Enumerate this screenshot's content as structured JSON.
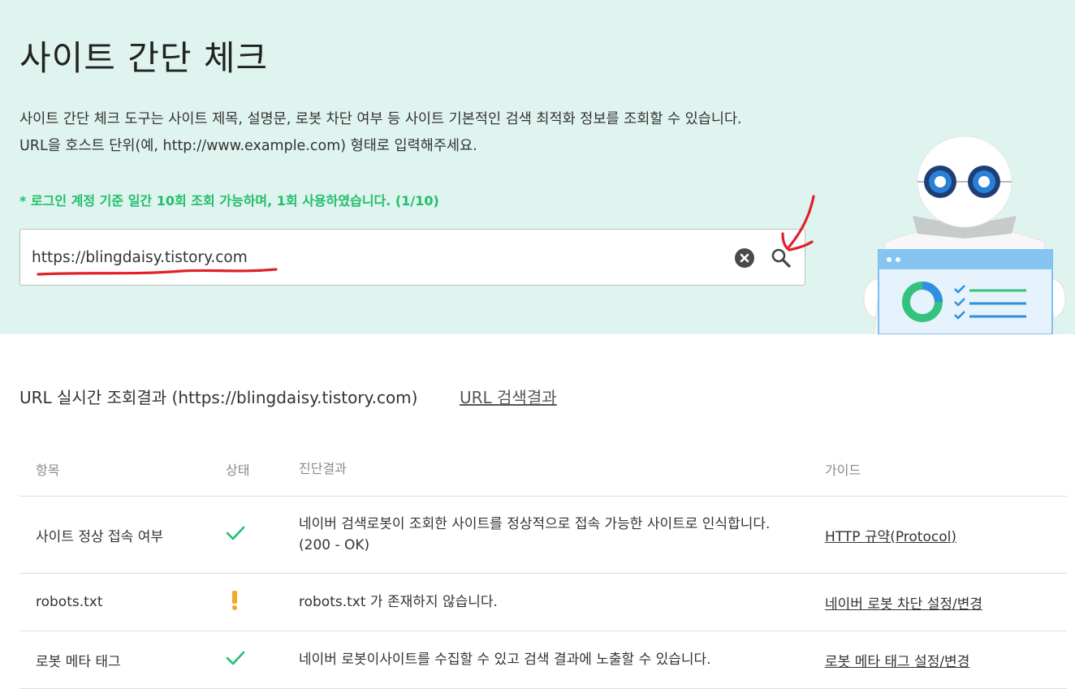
{
  "hero": {
    "title": "사이트 간단 체크",
    "description_line1": "사이트 간단 체크 도구는 사이트 제목, 설명문, 로봇 차단 여부 등 사이트 기본적인 검색 최적화 정보를 조회할 수 있습니다.",
    "description_line2": "URL을 호스트 단위(예, http://www.example.com) 형태로 입력해주세요.",
    "notice": "* 로그인 계정 기준 일간 10회 조회 가능하며, 1회 사용하였습니다. (1/10)",
    "background_color": "#dff3ef",
    "notice_color": "#1fbf6a"
  },
  "search": {
    "value": "https://blingdaisy.tistory.com",
    "clear_icon": "clear-circle-x-icon",
    "search_icon": "magnifier-icon"
  },
  "annotations": {
    "color": "#e0202a",
    "items": [
      "red-underline",
      "red-arrow"
    ]
  },
  "results": {
    "heading": "URL 실시간 조회결과 (https://blingdaisy.tistory.com)",
    "search_results_link": "URL 검색결과",
    "columns": [
      "항목",
      "상태",
      "진단결과",
      "가이드"
    ],
    "rows": [
      {
        "item": "사이트 정상 접속 여부",
        "status": "ok",
        "status_icon": "check-icon",
        "result_line1": "네이버 검색로봇이 조회한 사이트를 정상적으로 접속 가능한 사이트로 인식합니다.",
        "result_line2": "(200 - OK)",
        "guide": "HTTP 규약(Protocol)"
      },
      {
        "item": "robots.txt",
        "status": "warning",
        "status_icon": "exclamation-icon",
        "result_line1": "robots.txt 가 존재하지 않습니다.",
        "result_line2": "",
        "guide": "네이버 로봇 차단 설정/변경"
      },
      {
        "item": "로봇 메타 태그",
        "status": "ok",
        "status_icon": "check-icon",
        "result_line1": "네이버 로봇이사이트를 수집할 수 있고 검색 결과에 노출할 수 있습니다.",
        "result_line2": "",
        "guide": "로봇 메타 태그 설정/변경"
      }
    ],
    "ok_color": "#1fbf6a",
    "warning_color": "#f5a623"
  }
}
